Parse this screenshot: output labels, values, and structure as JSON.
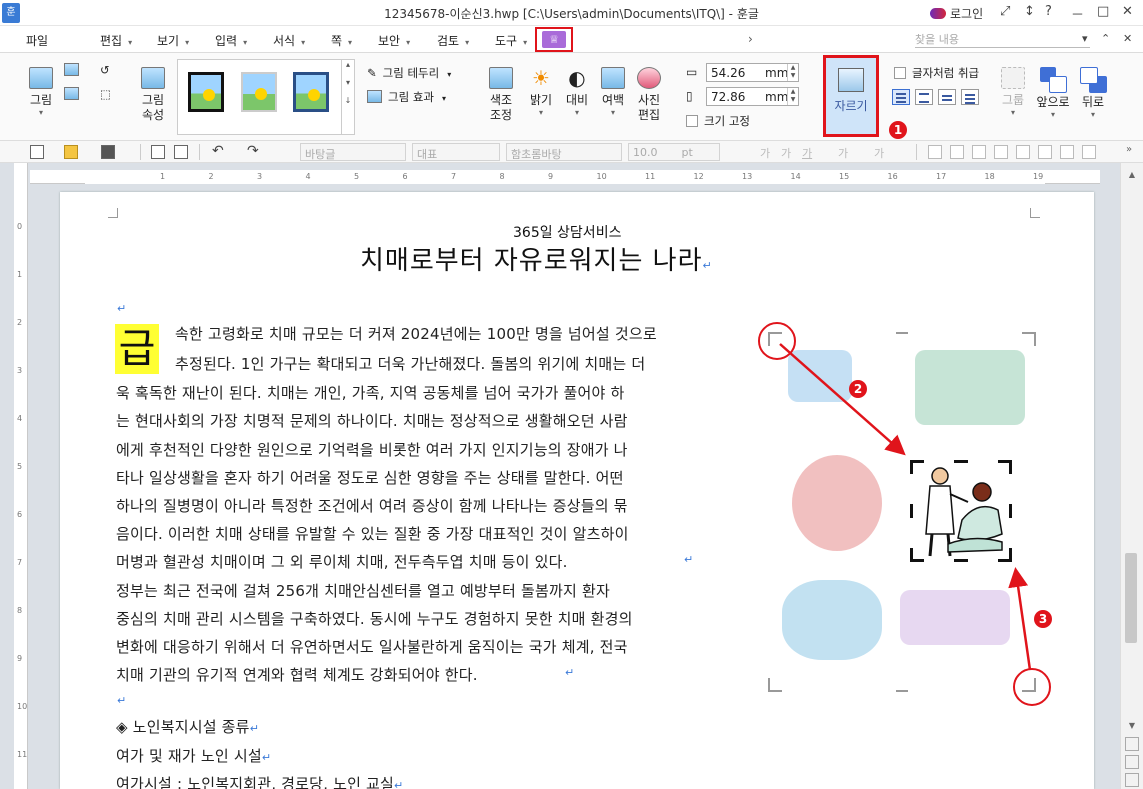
{
  "window": {
    "app_icon": "훈",
    "title": "12345678-이순신3.hwp [C:\\Users\\admin\\Documents\\ITQ\\] - 훈글",
    "login": "로그인",
    "controls": [
      "⤢",
      "↕",
      "?",
      "－",
      "□",
      "✕"
    ]
  },
  "menu": {
    "items": [
      "파일",
      "편집",
      "보기",
      "입력",
      "서식",
      "쪽",
      "보안",
      "검토",
      "도구"
    ],
    "arrow": "›",
    "search_placeholder": "찾을 내용",
    "right": [
      "▾",
      "⌃",
      "✕"
    ]
  },
  "ribbon": {
    "picture": "그림",
    "picture_props": "그림\n속성",
    "border": "그림 테두리",
    "effect": "그림 효과",
    "color_adjust": "색조\n조정",
    "brightness": "밝기",
    "contrast": "대비",
    "margin": "여백",
    "photo_edit": "사진\n편집",
    "width_value": "54.26",
    "height_value": "72.86",
    "unit": "mm",
    "size_fixed": "크기 고정",
    "crop": "자르기",
    "treat_as_char": "글자처럼 취급",
    "group": "그룹",
    "front": "앞으로",
    "back": "뒤로"
  },
  "format_bar": {
    "style": "바탕글",
    "lang": "대표",
    "font": "함초롬바탕",
    "size": "10.0",
    "size_unit": "pt",
    "char_buttons": [
      "가",
      "가",
      "가",
      "가",
      "가"
    ]
  },
  "ruler": {
    "numbers": [
      "1",
      "2",
      "3",
      "4",
      "5",
      "6",
      "7",
      "8",
      "9",
      "10",
      "11",
      "12",
      "13",
      "14",
      "15",
      "16",
      "17",
      "18",
      "19"
    ],
    "vnumbers": [
      "0",
      "1",
      "2",
      "3",
      "4",
      "5",
      "6",
      "7",
      "8",
      "9",
      "10",
      "11",
      "12"
    ]
  },
  "document": {
    "subtitle": "365일 상담서비스",
    "title": "치매로부터 자유로워지는 나라",
    "dropcap": "급",
    "lines": [
      "속한 고령화로 치매 규모는 더 커져 2024년에는 100만 명을 넘어설 것으로",
      "추정된다. 1인 가구는 확대되고 더욱 가난해졌다. 돌봄의 위기에 치매는 더",
      "욱 혹독한 재난이 된다. 치매는 개인, 가족, 지역 공동체를 넘어 국가가 풀어야 하",
      "는 현대사회의 가장 치명적 문제의 하나이다. 치매는 정상적으로 생활해오던 사람",
      "에게 후천적인 다양한 원인으로 기억력을 비롯한 여러 가지 인지기능의 장애가 나",
      "타나 일상생활을 혼자 하기 어려울 정도로 심한 영향을 주는 상태를 말한다. 어떤",
      "하나의 질병명이 아니라 특정한 조건에서 여려 증상이 함께 나타나는 증상들의 묶",
      "음이다. 이러한 치매 상태를 유발할 수 있는 질환 중 가장 대표적인 것이 알츠하이",
      "머병과 혈관성 치매이며 그 외 루이체 치매, 전두측두엽 치매 등이 있다.",
      "  정부는 최근 전국에 걸쳐 256개 치매안심센터를 열고 예방부터 돌봄까지 환자",
      "중심의 치매 관리 시스템을 구축하였다. 동시에 누구도 경험하지 못한 치매 환경의",
      "변화에 대응하기 위해서 더 유연하면서도 일사불란하게 움직이는 국가 체계, 전국",
      "치매 기관의 유기적 연계와 협력 체계도 강화되어야 한다."
    ],
    "section_heading": "◈ 노인복지시설 종류",
    "list_1": "여가 및 재가 노인 시설",
    "list_2": "여가시설 : 노인복지회관, 경로당, 노인 교실",
    "para_mark": "↵"
  },
  "annotations": {
    "badge_1": "1",
    "badge_2": "2",
    "badge_3": "3",
    "color": "#e0141b"
  }
}
